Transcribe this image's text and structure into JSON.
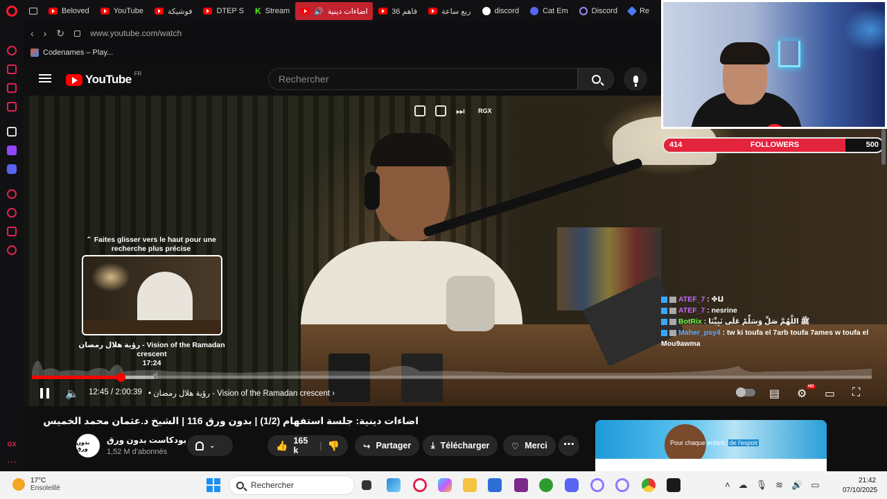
{
  "browser": {
    "tabs": [
      {
        "label": "Beloved",
        "icon": "youtube-icon",
        "active": false
      },
      {
        "label": "YouTube",
        "icon": "youtube-icon",
        "active": false
      },
      {
        "label": "فوشيكة",
        "icon": "youtube-icon",
        "active": false
      },
      {
        "label": "DTEP S",
        "icon": "youtube-icon",
        "active": false
      },
      {
        "label": "Stream",
        "icon": "kick-icon",
        "active": false
      },
      {
        "label": "اضاءات دينية",
        "icon": "youtube-icon",
        "active": true
      },
      {
        "label": "فاهم 36",
        "icon": "youtube-icon",
        "active": false
      },
      {
        "label": "ربع ساعة",
        "icon": "youtube-icon",
        "active": false
      },
      {
        "label": "discord",
        "icon": "google-icon",
        "active": false
      },
      {
        "label": "Cat Em",
        "icon": "discord-icon",
        "active": false
      },
      {
        "label": "Discord",
        "icon": "opera-icon",
        "active": false
      },
      {
        "label": "Re",
        "icon": "diamond-icon",
        "active": false
      }
    ],
    "url": "www.youtube.com/watch",
    "bookmark": "Codenames – Play..."
  },
  "youtube": {
    "logo_text": "YouTube",
    "country_code": "FR",
    "search_placeholder": "Rechercher"
  },
  "player": {
    "top_controls_label": "RGX",
    "seek_hint": "⌃ Faites glisser vers le haut pour une recherche plus précise",
    "preview_title": "رؤية هلال رمضان - Vision of the Ramadan crescent",
    "preview_time": "17:24",
    "current_time": "12:45 / 2:00:39",
    "chapter": "رؤية هلال رمضان - Vision of the Ramadan crescent",
    "played_fraction": 0.106,
    "buffered_fraction": 0.145,
    "hover_fraction": 0.145,
    "hd_badge": "HD"
  },
  "chat": [
    {
      "user": "ATEF_7",
      "color": "#c06cff",
      "message": ": ✤ⵡ"
    },
    {
      "user": "ATEF_7",
      "color": "#c06cff",
      "message": ": nesrine"
    },
    {
      "user": "BotRix",
      "color": "#6cff4a",
      "message": ": ﷺ اللَّهُمَّ صَلِّ وَسَلِّمْ عَلَى نَبِيِّنَا"
    },
    {
      "user": "Maher_psy4",
      "color": "#5aa9ff",
      "message": ": tw ki toufa el 7arb toufa 7ames w toufa el Mou9awma"
    }
  ],
  "overlay": {
    "followers_current": "414",
    "followers_label": "FOLLOWERS",
    "followers_goal": "500",
    "followers_fraction": 0.828
  },
  "video": {
    "title": "اضاءات دينية: جلسة استفهام (1/2) | بدون ورق 116 | الشيخ د.عثمان محمد الخميس",
    "channel_name": "بودكاست بدون ورق",
    "channel_avatar_text": "بدون ورق",
    "subscribers": "1,52 M d'abonnés",
    "likes": "165 k",
    "share_label": "Partager",
    "download_label": "Télécharger",
    "thanks_label": "Merci",
    "more_label": "⋯"
  },
  "ad": {
    "text_plain": "Pour chaque enfant,",
    "text_highlight": "de l'espoir"
  },
  "taskbar": {
    "temperature": "17°C",
    "weather": "Ensoleillé",
    "search_label": "Rechercher",
    "time": "21:42",
    "date": "07/10/2025"
  },
  "colors": {
    "youtube_red": "#ff0000",
    "opera_red": "#ff1b2d",
    "active_tab": "#c2232f",
    "followers_bar": "#e4233c"
  }
}
